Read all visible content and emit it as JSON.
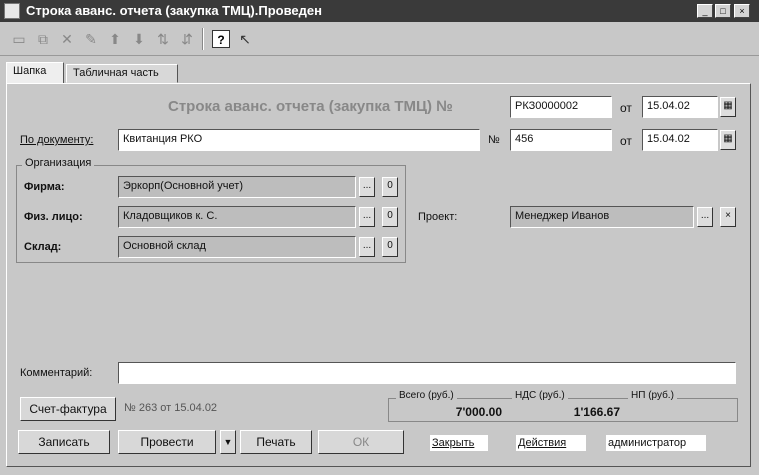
{
  "window": {
    "title": "Строка аванс. отчета (закупка ТМЦ).Проведен",
    "minimize": "_",
    "maximize": "□",
    "close": "×"
  },
  "toolbar": {
    "icons": [
      "new-icon",
      "copy-icon",
      "delete-icon",
      "edit-icon",
      "arrow-up-icon",
      "arrow-down-icon",
      "sort-asc-icon",
      "sort-desc-icon",
      "help-icon",
      "context-help-icon"
    ],
    "help_label": "?"
  },
  "tabs": [
    {
      "label": "Шапка"
    },
    {
      "label": "Табличная часть"
    }
  ],
  "header": {
    "doc_title": "Строка аванс. отчета (закупка ТМЦ) №",
    "doc_number": "РКЗ0000002",
    "from_label": "от",
    "doc_date": "15.04.02",
    "basis_label": "По документу:",
    "basis_value": "Квитанция РКО",
    "num_label": "№",
    "basis_number": "456",
    "basis_date": "15.04.02"
  },
  "org": {
    "group_label": "Организация",
    "firm_label": "Фирма:",
    "firm_value": "Эркорп(Основной учет)",
    "person_label": "Физ. лицо:",
    "person_value": "Кладовщиков к. С.",
    "warehouse_label": "Склад:",
    "warehouse_value": "Основной склад",
    "ellipsis": "...",
    "clear": "0"
  },
  "project": {
    "label": "Проект:",
    "value": "Менеджер Иванов",
    "ellipsis": "...",
    "clear": "×"
  },
  "comment": {
    "label": "Комментарий:",
    "value": ""
  },
  "invoice": {
    "button": "Счет-фактура",
    "info": "№ 263 от 15.04.02"
  },
  "totals": {
    "total_label": "Всего (руб.)",
    "total_value": "7'000.00",
    "vat_label": "НДС (руб.)",
    "vat_value": "1'166.67",
    "np_label": "НП (руб.)",
    "np_value": ""
  },
  "buttons": {
    "save": "Записать",
    "post": "Провести",
    "arrow": "▼",
    "print": "Печать",
    "ok": "ОК",
    "close": "Закрыть",
    "actions": "Действия",
    "admin": "администратор"
  }
}
